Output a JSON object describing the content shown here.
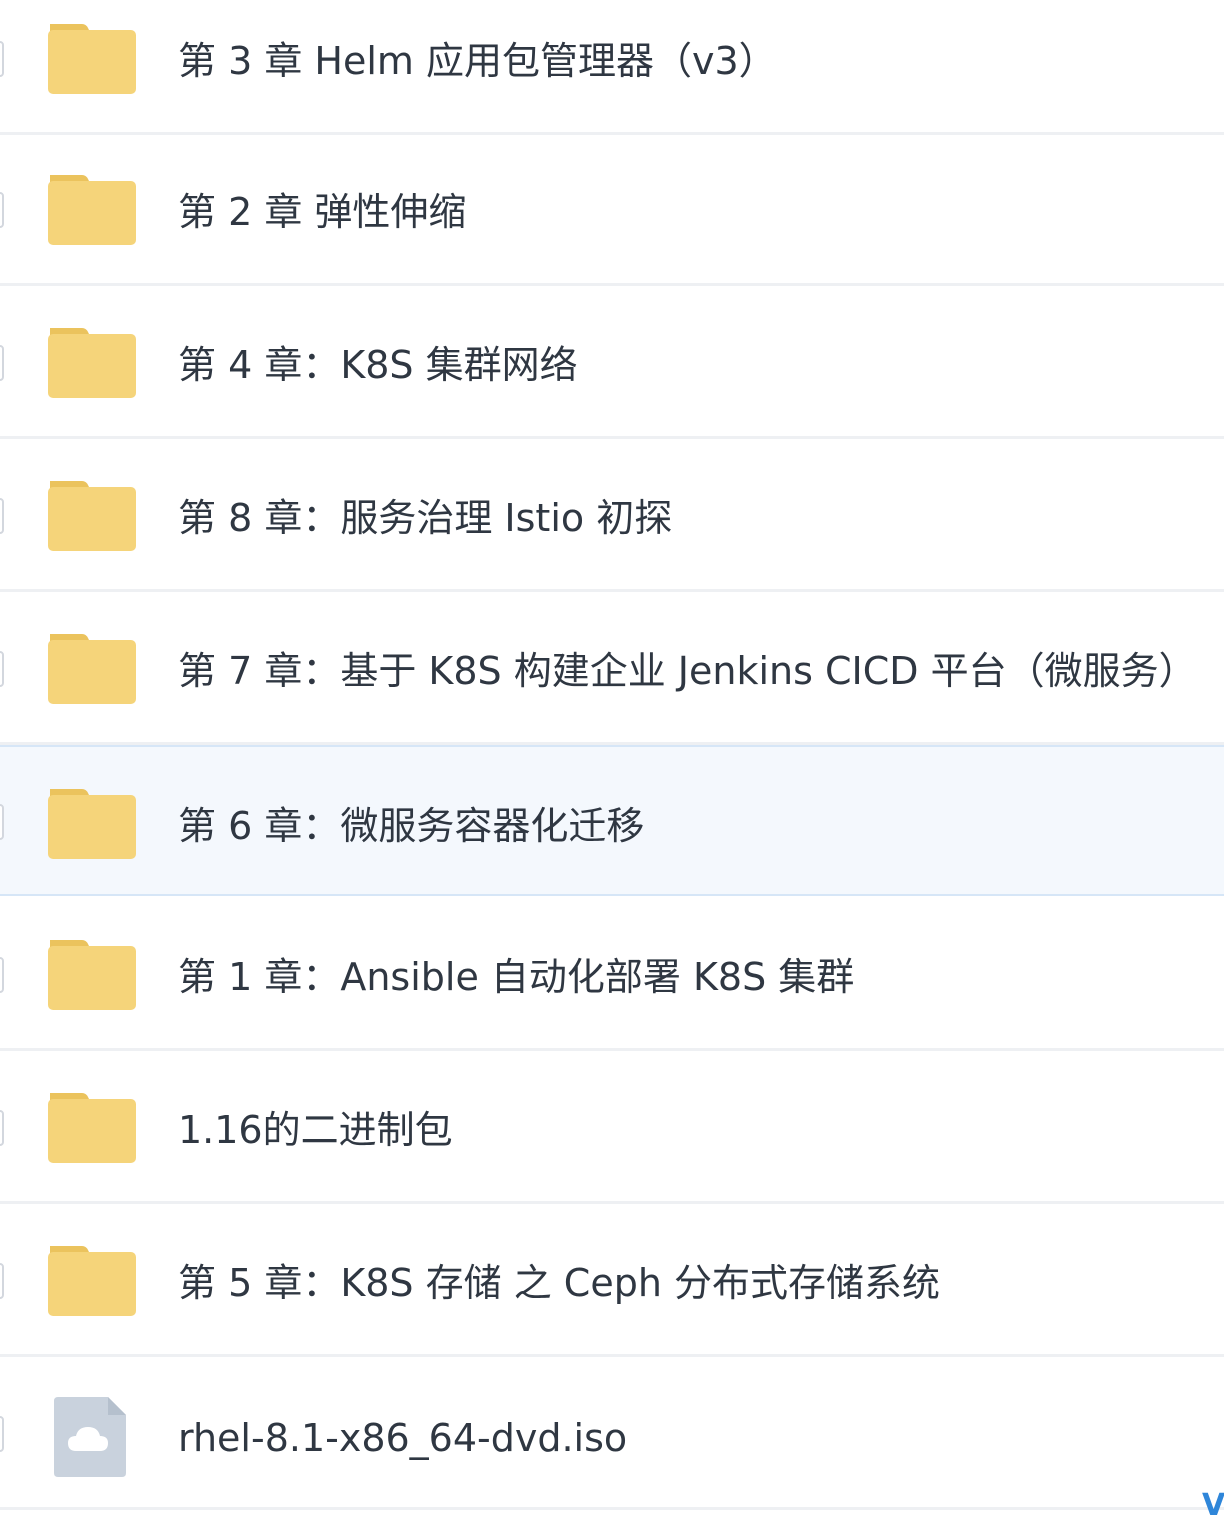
{
  "files": [
    {
      "name": "第 3 章 Helm 应用包管理器（v3）",
      "icon": "folder-icon",
      "selected": false
    },
    {
      "name": "第 2 章 弹性伸缩",
      "icon": "folder-icon",
      "selected": false
    },
    {
      "name": "第 4 章：K8S 集群网络",
      "icon": "folder-icon",
      "selected": false
    },
    {
      "name": "第 8 章：服务治理 Istio 初探",
      "icon": "folder-icon",
      "selected": false
    },
    {
      "name": "第 7 章：基于 K8S 构建企业 Jenkins CICD 平台（微服务）",
      "icon": "folder-icon",
      "selected": false
    },
    {
      "name": "第 6 章：微服务容器化迁移",
      "icon": "folder-icon",
      "selected": true
    },
    {
      "name": "第 1 章：Ansible 自动化部署 K8S 集群",
      "icon": "folder-icon",
      "selected": false
    },
    {
      "name": "1.16的二进制包",
      "icon": "folder-icon",
      "selected": false
    },
    {
      "name": "第 5 章：K8S 存储 之 Ceph 分布式存储系统",
      "icon": "folder-icon",
      "selected": false
    },
    {
      "name": "rhel-8.1-x86_64-dvd.iso",
      "icon": "cloud-file-icon",
      "selected": false
    }
  ],
  "corner_mark": "V",
  "colors": {
    "folder": "#f5d47a",
    "folder_tab": "#ebc35d",
    "file_icon": "#c9d2dd",
    "selected_bg": "#f4f8fd",
    "text": "#2f3742"
  }
}
